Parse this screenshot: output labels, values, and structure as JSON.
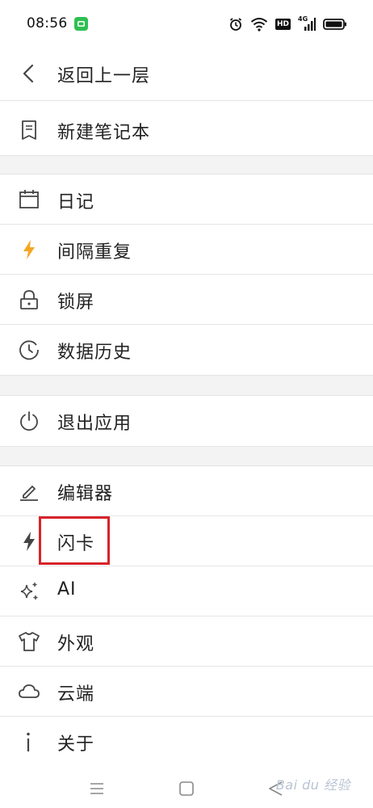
{
  "status_bar": {
    "time": "08:56",
    "network": "4G",
    "hd": "HD"
  },
  "back": {
    "label": "返回上一层"
  },
  "menu": {
    "new_notebook": "新建笔记本",
    "diary": "日记",
    "spaced_repetition": "间隔重复",
    "lock_screen": "锁屏",
    "data_history": "数据历史",
    "exit_app": "退出应用",
    "editor": "编辑器",
    "flashcard": "闪卡",
    "ai": "AI",
    "appearance": "外观",
    "cloud": "云端",
    "about": "关于"
  },
  "colors": {
    "accent_lightning": "#f5a623",
    "highlight_box": "#d8232a",
    "wechat_green": "#2fbf52",
    "icon_gray": "#444444"
  },
  "watermark": "Bai du 经验"
}
